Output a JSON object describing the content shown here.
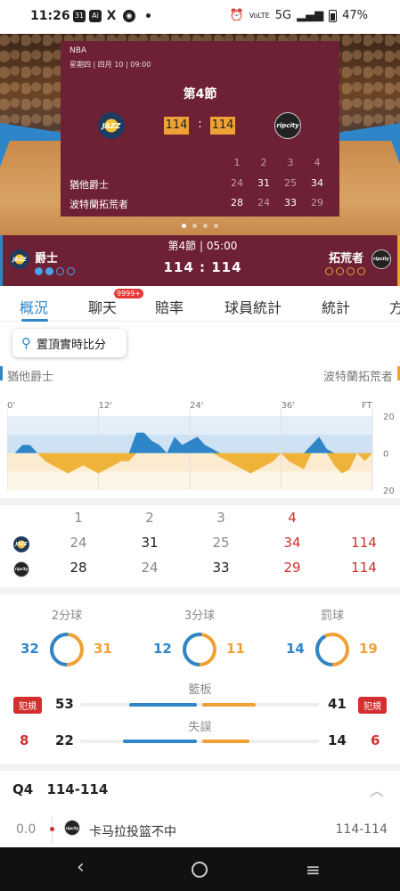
{
  "status_bar": {
    "time": "11:26",
    "network": "5G",
    "lte": "VoLTE",
    "battery": "47%"
  },
  "hero": {
    "league": "NBA",
    "datetime": "星期四 | 四月 10 | 09:00",
    "period": "第4節",
    "home_logo": "JAZZ",
    "away_logo": "ripcity",
    "home_score": "114",
    "away_score": "114",
    "colon": ":",
    "quarters": [
      "1",
      "2",
      "3",
      "4"
    ],
    "rows": [
      {
        "team": "猶他爵士",
        "q": [
          "24",
          "31",
          "25",
          "34"
        ]
      },
      {
        "team": "波特蘭拓荒者",
        "q": [
          "28",
          "24",
          "33",
          "29"
        ]
      }
    ],
    "pager_count": 4,
    "pager_active": 0
  },
  "scorebar": {
    "period_clock": "第4節 | 05:00",
    "home_name": "爵士",
    "away_name": "拓荒者",
    "score": "114  :  114",
    "home_timeouts_used": 2,
    "away_timeouts_used": 0
  },
  "tabs": [
    {
      "label": "概況",
      "active": true
    },
    {
      "label": "聊天",
      "badge": "9999+"
    },
    {
      "label": "賠率"
    },
    {
      "label": "球員統計"
    },
    {
      "label": "統計"
    },
    {
      "label": "方"
    }
  ],
  "pin_button": "置頂實時比分",
  "legend": {
    "home": "猶他爵士",
    "away": "波特蘭拓荒者",
    "home_color": "#2e86c8",
    "away_color": "#f0a136"
  },
  "chart_data": {
    "type": "area",
    "title": "",
    "x_ticks": [
      "0'",
      "12'",
      "24'",
      "36'",
      "FT"
    ],
    "y_ticks": [
      "20",
      "0",
      "20"
    ],
    "ylim": [
      -20,
      20
    ],
    "x": [
      0,
      1,
      2,
      3,
      4,
      5,
      6,
      7,
      8,
      9,
      10,
      11,
      12,
      13,
      14,
      15,
      16,
      17,
      18,
      19,
      20,
      21,
      22,
      23,
      24,
      25,
      26,
      27,
      28,
      29,
      30,
      31,
      32,
      33,
      34,
      35,
      36,
      37,
      38,
      39,
      40,
      41,
      42,
      43,
      44,
      45,
      46,
      47,
      48
    ],
    "series": [
      {
        "name": "猶他爵士",
        "values": [
          0,
          0,
          2,
          2,
          0,
          -2,
          -3,
          -4,
          -5,
          -4,
          -3,
          -4,
          -5,
          -4,
          -3,
          -2,
          -2,
          5,
          5,
          3,
          2,
          0,
          4,
          2,
          3,
          4,
          2,
          1,
          -1,
          -2,
          -3,
          -4,
          -5,
          -4,
          -3,
          -2,
          0,
          -2,
          -3,
          -4,
          2,
          4,
          1,
          -3,
          -5,
          -4,
          0,
          -2,
          0
        ]
      }
    ]
  },
  "box": {
    "headers": [
      "1",
      "2",
      "3",
      "4",
      ""
    ],
    "home": [
      "24",
      "31",
      "25",
      "34",
      "114"
    ],
    "away": [
      "28",
      "24",
      "33",
      "29",
      "114"
    ]
  },
  "shooting": [
    {
      "label": "2分球",
      "home": "32",
      "away": "31",
      "home_pct": 51
    },
    {
      "label": "3分球",
      "home": "12",
      "away": "11",
      "home_pct": 52
    },
    {
      "label": "罰球",
      "home": "14",
      "away": "19",
      "home_pct": 42
    }
  ],
  "rebounds": {
    "label": "籃板",
    "home": "53",
    "away": "41",
    "home_pct": 56
  },
  "turnovers": {
    "label": "失誤",
    "home": "22",
    "away": "14",
    "home_pct": 61
  },
  "fouls": {
    "tag": "犯規",
    "home": "8",
    "away": "6"
  },
  "pbp": {
    "quarter": "Q4",
    "score": "114-114",
    "rows": [
      {
        "time": "0.0",
        "text": "卡马拉投篮不中",
        "score": "114-114"
      }
    ]
  },
  "nav": {
    "back": "back-icon",
    "home": "home-icon",
    "menu": "menu-icon"
  }
}
